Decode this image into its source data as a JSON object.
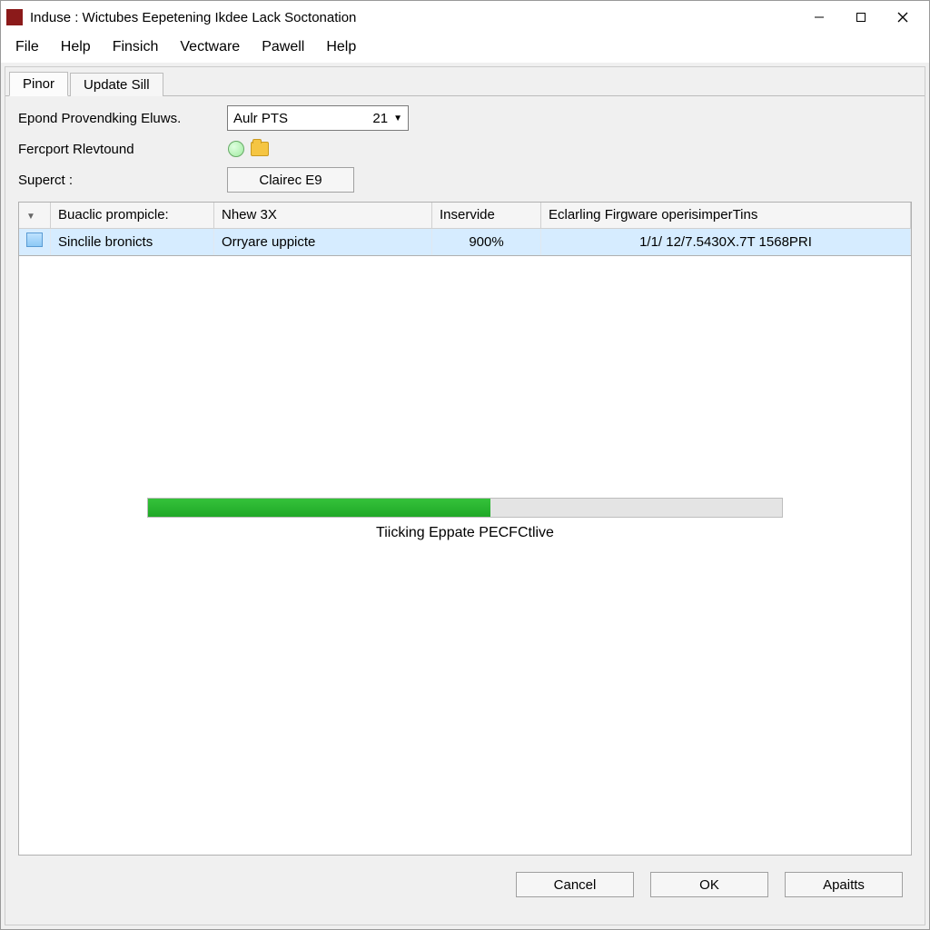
{
  "titlebar": {
    "app_icon_name": "app-icon",
    "title": "Induse : Wictubes Eepetening Ikdee Lack Soctonation"
  },
  "menubar": {
    "items": [
      "File",
      "Help",
      "Finsich",
      "Vectware",
      "Pawell",
      "Help"
    ]
  },
  "tabs": {
    "items": [
      {
        "label": "Pinor",
        "active": true
      },
      {
        "label": "Update Sill",
        "active": false
      }
    ]
  },
  "form": {
    "row1_label": "Epond Provendking Eluws.",
    "row1_value": "Aulr PTS",
    "row1_num": "21",
    "row2_label": "Fercport Rlevtound",
    "row3_label": "Superct :",
    "row3_button": "Clairec E9"
  },
  "table": {
    "headers": [
      "",
      "Buaclic prompicle:",
      "Nhew 3X",
      "Inservide",
      "Eclarling Firgware operisimperTins"
    ],
    "row": {
      "c1": "Sinclile bronicts",
      "c2": "Orryare uppicte",
      "c3": "900%",
      "c4": "1/1/ 12/7.5430X.7T 1568PRI"
    }
  },
  "progress": {
    "percent": 54,
    "label": "Tiicking Eppate PECFCtlive"
  },
  "footer": {
    "cancel": "Cancel",
    "ok": "OK",
    "apply": "Apaitts"
  }
}
